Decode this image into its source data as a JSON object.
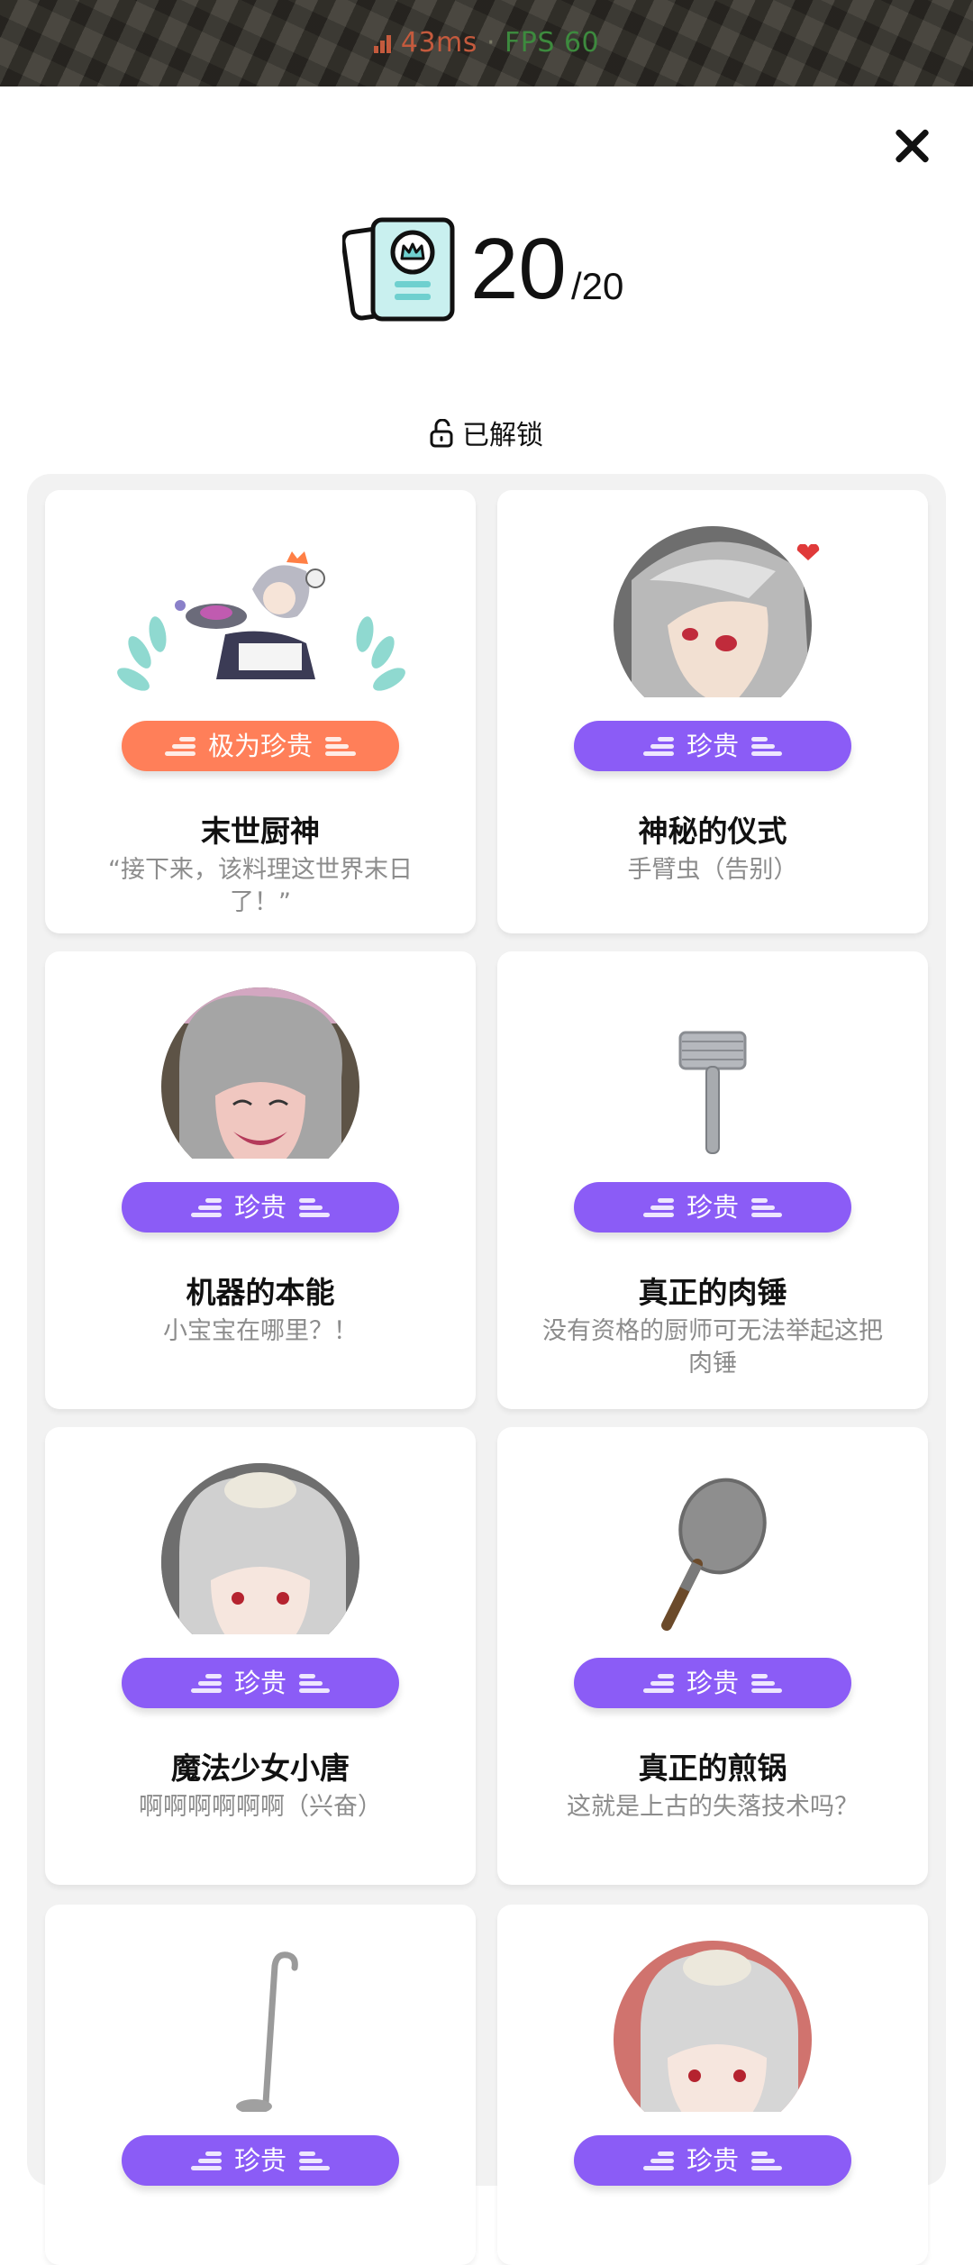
{
  "status": {
    "latency": "43ms",
    "separator": "·",
    "fps": "FPS 60"
  },
  "header": {
    "count": "20",
    "total": "/20"
  },
  "section": {
    "label": "已解锁"
  },
  "cards": [
    {
      "rarity": "极为珍贵",
      "title": "末世厨神",
      "desc": "“接下来，该料理这世界末日了！”"
    },
    {
      "rarity": "珍贵",
      "title": "神秘的仪式",
      "desc": "手臂虫（告别）"
    },
    {
      "rarity": "珍贵",
      "title": "机器的本能",
      "desc": "小宝宝在哪里？！"
    },
    {
      "rarity": "珍贵",
      "title": "真正的肉锤",
      "desc": "没有资格的厨师可无法举起这把肉锤"
    },
    {
      "rarity": "珍贵",
      "title": "魔法少女小唐",
      "desc": "啊啊啊啊啊啊（兴奋）"
    },
    {
      "rarity": "珍贵",
      "title": "真正的煎锅",
      "desc": "这就是上古的失落技术吗？"
    },
    {
      "rarity": "珍贵",
      "title": "",
      "desc": ""
    },
    {
      "rarity": "珍贵",
      "title": "",
      "desc": ""
    }
  ],
  "colors": {
    "rare": "#8b5cf6",
    "epic": "#ff7f59",
    "panel": "#f2f2f2"
  }
}
